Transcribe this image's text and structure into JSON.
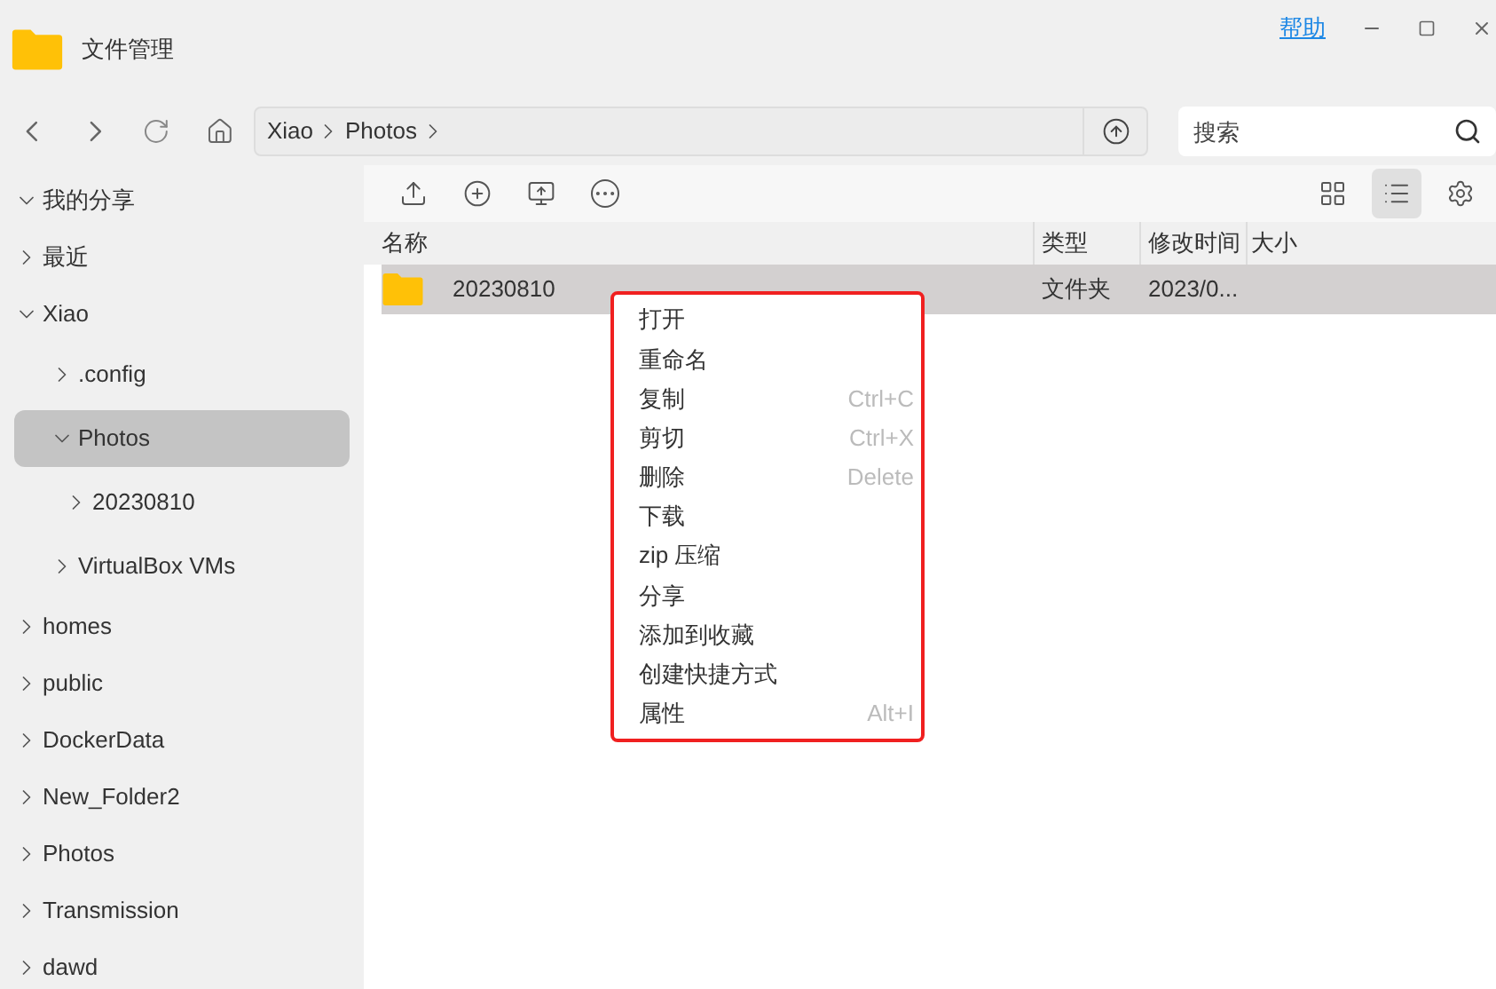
{
  "window": {
    "title": "文件管理",
    "help_link": "帮助"
  },
  "nav": {
    "breadcrumb": [
      "Xiao",
      "Photos"
    ],
    "search": {
      "placeholder": "搜索"
    }
  },
  "sidebar": {
    "items": [
      {
        "label": "我的分享",
        "expanded": true,
        "selected": false
      },
      {
        "label": "最近",
        "expanded": false,
        "selected": false
      },
      {
        "label": "Xiao",
        "expanded": true,
        "selected": false,
        "children": [
          {
            "label": ".config",
            "expanded": false,
            "selected": false
          },
          {
            "label": "Photos",
            "expanded": true,
            "selected": true,
            "children": [
              {
                "label": "20230810",
                "expanded": false,
                "selected": false
              }
            ]
          },
          {
            "label": "VirtualBox VMs",
            "expanded": false,
            "selected": false
          }
        ]
      },
      {
        "label": "homes",
        "expanded": false,
        "selected": false
      },
      {
        "label": "public",
        "expanded": false,
        "selected": false
      },
      {
        "label": "DockerData",
        "expanded": false,
        "selected": false
      },
      {
        "label": "New_Folder2",
        "expanded": false,
        "selected": false
      },
      {
        "label": "Photos",
        "expanded": false,
        "selected": false
      },
      {
        "label": "Transmission",
        "expanded": false,
        "selected": false
      },
      {
        "label": "dawd",
        "expanded": false,
        "selected": false
      }
    ]
  },
  "toolbar": {
    "view_buttons": [
      {
        "kind": "grid",
        "selected": false
      },
      {
        "kind": "list",
        "selected": true
      }
    ]
  },
  "table": {
    "columns": [
      "名称",
      "类型",
      "修改时间",
      "大小"
    ],
    "rows": [
      {
        "name": "20230810",
        "type": "文件夹",
        "modified": "2023/0...",
        "selected": true
      }
    ]
  },
  "context_menu": [
    {
      "label": "打开"
    },
    {
      "label": "重命名"
    },
    {
      "label": "复制",
      "shortcut": "Ctrl+C"
    },
    {
      "label": "剪切",
      "shortcut": "Ctrl+X"
    },
    {
      "label": "删除",
      "shortcut": "Delete"
    },
    {
      "label": "下载"
    },
    {
      "label": "zip 压缩"
    },
    {
      "label": "分享"
    },
    {
      "label": "添加到收藏"
    },
    {
      "label": "创建快捷方式"
    },
    {
      "label": "属性",
      "shortcut": "Alt+I"
    }
  ]
}
